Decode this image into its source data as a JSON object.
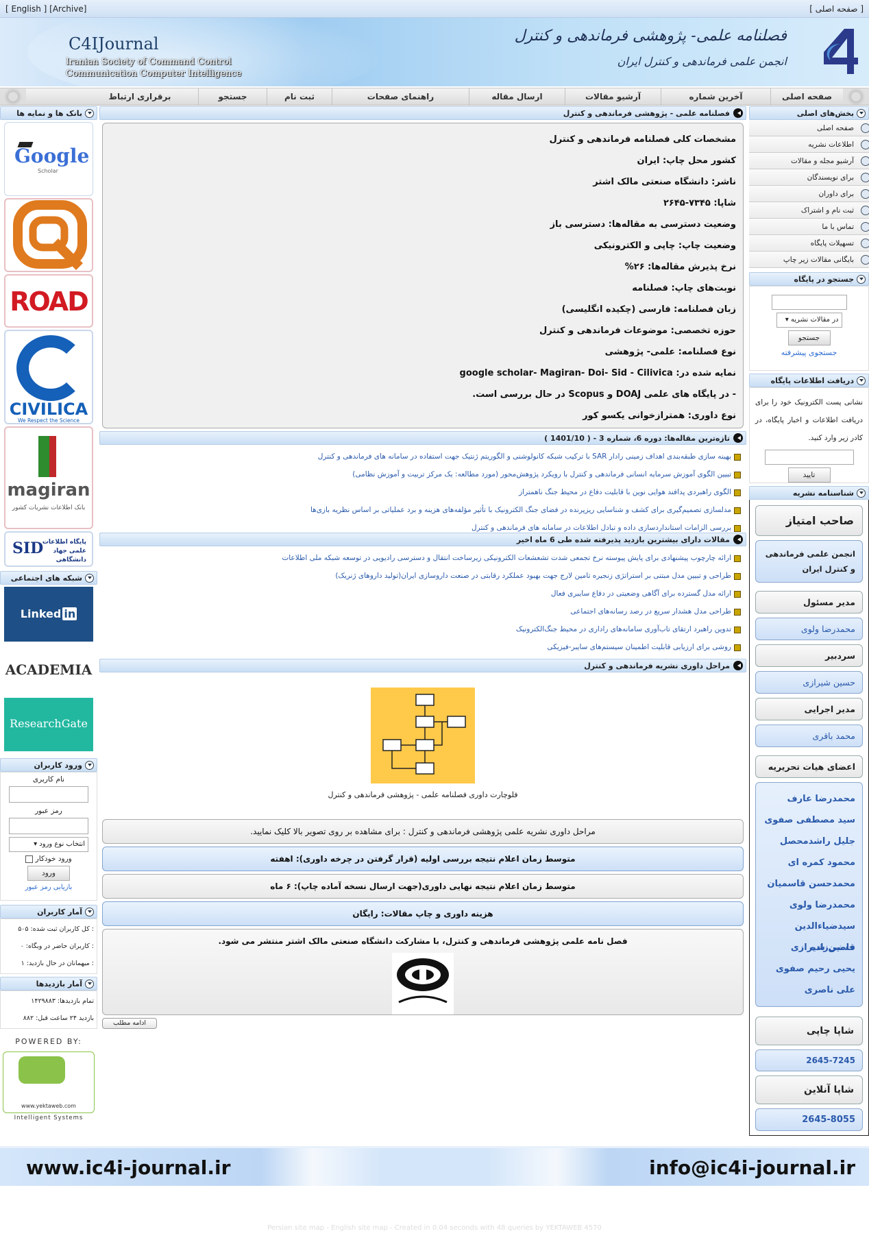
{
  "topbar": {
    "left": "[ English ] [Archive]",
    "right": "[ صفحه اصلی ]"
  },
  "header": {
    "en_title": "C4IJournal",
    "en_sub1": "Iranian Society of Command Control",
    "en_sub2": "Communication Computer Intelligence",
    "fa_title": "فصلنامه علمی- پژوهشی فرماندهی و کنترل",
    "fa_sub": "انجمن علمی فرماندهی و کنترل ایران"
  },
  "menu": [
    "صفحه اصلی",
    "آخرین شماره",
    "آرشیو مقالات",
    "ارسال مقاله",
    "راهنمای صفحات",
    "ثبت نام",
    "جستجو",
    "برقراری ارتباط"
  ],
  "right": {
    "main_title": "بخش‌های اصلی",
    "main_items": [
      "صفحه اصلی",
      "اطلاعات نشریه",
      "آرشیو مجله و مقالات",
      "برای نویسندگان",
      "برای داوران",
      "ثبت نام و اشتراک",
      "تماس با ما",
      "تسهیلات پایگاه",
      "بایگانی مقالات زیر چاپ"
    ],
    "search_title": "جستجو در پایگاه",
    "search_select": "در مقالات نشریه",
    "search_btn": "جستجو",
    "search_adv": "جستجوی پیشرفته",
    "news_title": "دریافت اطلاعات پایگاه",
    "news_text": "نشانی پست الکترونیک خود را برای دریافت اطلاعات و اخبار پایگاه، در کادر زیر وارد کنید.",
    "news_btn": "تایید",
    "id_title": "شناسنامه نشریه",
    "owner_label": "صاحب امتیاز",
    "owner": "انجمن علمی فرماندهی و کنترل ایران",
    "manager_label": "مدیر مسئول",
    "manager": "محمدرضا ولوی",
    "chief_label": "سردبیر",
    "chief": "حسین شیرازی",
    "exec_label": "مدیر اجرایی",
    "exec": "محمد باقری",
    "board_label": "اعضای هیات تحریریه",
    "board": [
      "محمدرضا عارف",
      "سید مصطفی صفوی",
      "جلیل راشدمحصل",
      "محمود کمره ای",
      "محمدحسن قاسمیان",
      "محمدرضا ولوی",
      "سیدضیاءالدین قاضی‌زاده",
      "حسین شیرازی",
      "یحیی رحیم صفوی",
      "علی ناصری"
    ],
    "issn_print_label": "شاپا چاپی",
    "issn_print": "2645-7245",
    "issn_online_label": "شاپا آنلاین",
    "issn_online": "2645-8055"
  },
  "left": {
    "banks_title": "بانک ها و نمایه ها",
    "google": "Google",
    "scholar": "Scholar",
    "road": "ROAD",
    "civilica": "CIVILICA",
    "civilica_tag": "We Respect the Science",
    "magiran": "magiran",
    "magiran_sub": "بانک اطلاعات نشریات کشور",
    "sid": "SID",
    "sid_fa": "پایگاه اطلاعات علمی جهاد دانشگاهی",
    "social_title": "شبکه های اجتماعی",
    "linkedin": "Linked",
    "linkedin_in": "in",
    "academia": "ACADEMIA",
    "researchgate": "ResearchGate",
    "login_title": "ورود کاربران",
    "user_label": "نام کاربری",
    "pass_label": "رمز عبور",
    "login_type": "انتخاب نوع ورود",
    "remember": "ورود خودکار",
    "login_btn": "ورود",
    "recover": "بازیابی رمز عبور",
    "users_title": "آمار کاربران",
    "users_lines": [
      ": کل کاربران ثبت شده: ۵۰۵",
      ": کاربران حاضر در وبگاه: ۰",
      ": میهمانان در حال بازدید: ۱"
    ],
    "visits_title": "آمار بازدیدها",
    "visits_lines": [
      "تمام بازدیدها: ۱۴۲۹۸۸۳",
      "بازدید ۲۴ ساعت قبل: ۸۸۲"
    ],
    "powered": "POWERED BY:",
    "yw_site": "www.yektaweb.com",
    "yw_sub": "Intelligent Systems"
  },
  "main": {
    "intro_title": "فصلنامه علمی - پژوهشی فرماندهی و کنترل",
    "info": [
      "مشخصات کلی فصلنامه فرماندهی و کنترل",
      "کشور محل چاپ: ایران",
      "ناشر: دانشگاه صنعتی مالک اشتر",
      "شاپا: ۷۳۴۵-۲۶۴۵",
      "وضعیت دسترسی به مقاله‌ها: دسترسی باز",
      "وضعیت چاپ: چاپی و الکترونیکی",
      "نرخ پذیرش مقاله‌ها: ۲۶%",
      "نوبت‌های چاپ: فصلنامه",
      "زبان فصلنامه: فارسی (چکیده انگلیسی)",
      "حوزه تخصصی: موضوعات فرماندهی و کنترل",
      "نوع فصلنامه: علمی- پژوهشی",
      "نمایه شده در:  google scholar- Magiran- Doi- Sid - Cilivica",
      "- در پایگاه های علمی DOAJ و Scopus  در حال بررسی است.",
      "نوع داوری: همترازخوانی یکسو کور"
    ],
    "latest_title": "تازه‌ترین مقاله‌ها: دوره 6، شماره 3 - ( 1401/10 )",
    "latest": [
      "بهینه سازی طبقه‌بندی اهداف زمینی رادار SAR با ترکیب شبکه کانولوشنی و الگوریتم ژنتیک جهت استفاده در سامانه های فرماندهی و کنترل",
      "تبیین الگوی آموزش سرمایه انسانی فرماندهی و کنترل با رویکرد پژوهش‌محور (مورد مطالعه: یک مرکز تربیت و آموزش نظامی)",
      "الگوی راهبردی پدافند هوایی نوین با قابلیت دفاع در محیط جنگ ناهمتراز",
      "مدلسازی تصمیم‌گیری برای کشف و شناسایی ریزپرنده در فضای جنگ الکترونیک با تأثیر مؤلفه‌های هزینه و برد عملیاتی بر اساس نظریه بازی‌ها",
      "بررسی الزامات استاندارد‌سازی داده و تبادل اطلاعات در سامانه های فرماندهی و کنترل"
    ],
    "popular_title": "مقالات دارای بیشترین بازدید پذیرفته شده طی 6 ماه اخیر",
    "popular": [
      "ارائه چارچوب پیشنهادی برای پایش پیوسته نرخ تجمعی شدت تشعشعات الکترونیکی زیرساخت انتقال و دسترسی رادیویی در توسعه شبکه ملی اطلاعات",
      "طراحی و تبیین مدل مبتنی بر استراتژی زنجیره تامین لارج جهت بهبود عملکرد رقابتی در صنعت داروسازی ایران(تولید داروهای ژنریک)",
      "ارائه مدل گسترده برای آگاهی وضعیتی در دفاع سایبری فعال",
      "طراحی مدل هشدار سریع در رصد رسانه‌های اجتماعی",
      "تدوین راهبرد ارتقای تاب‌آوری سامانه‌های راداری در محیط جنگ‌الکترونیک",
      "روشی برای ارزیابی قابلیت اطمینان سیستم‌های سایبر-فیزیکی"
    ],
    "review_title": "مراحل داوری نشریه فرماندهی و کنترل",
    "flow_caption": "فلوچارت داوری فصلنامه علمی - پژوهشی فرماندهی و کنترل",
    "r1": "مراحل داوری نشریه علمی پژوهشی فرماندهی و کنترل :  برای مشاهده بر روی تصویر بالا کلیک نمایید.",
    "r2": "متوسط زمان اعلام نتیجه بررسی اولیه (قرار گرفتن در چرخه داوری): اهفته",
    "r3": "متوسط زمان اعلام نتیجه نهایی داوری(جهت ارسال نسخه آماده چاپ): ۶ ماه",
    "r4": "هزینه داوری و چاپ مقالات: رایگان",
    "r5": "فصل نامه علمی پژوهشی فرماندهی و کنترل، با مشارکت دانشگاه صنعتی مالک اشتر منتشر می شود.",
    "more": "ادامه مطلب"
  },
  "footer": {
    "site": "www.ic4i-journal.ir",
    "email": "info@ic4i-journal.ir",
    "copy": "Persian site map - English site map - Created in 0.04 seconds with 48 queries by YEKTAWEB 4570"
  }
}
